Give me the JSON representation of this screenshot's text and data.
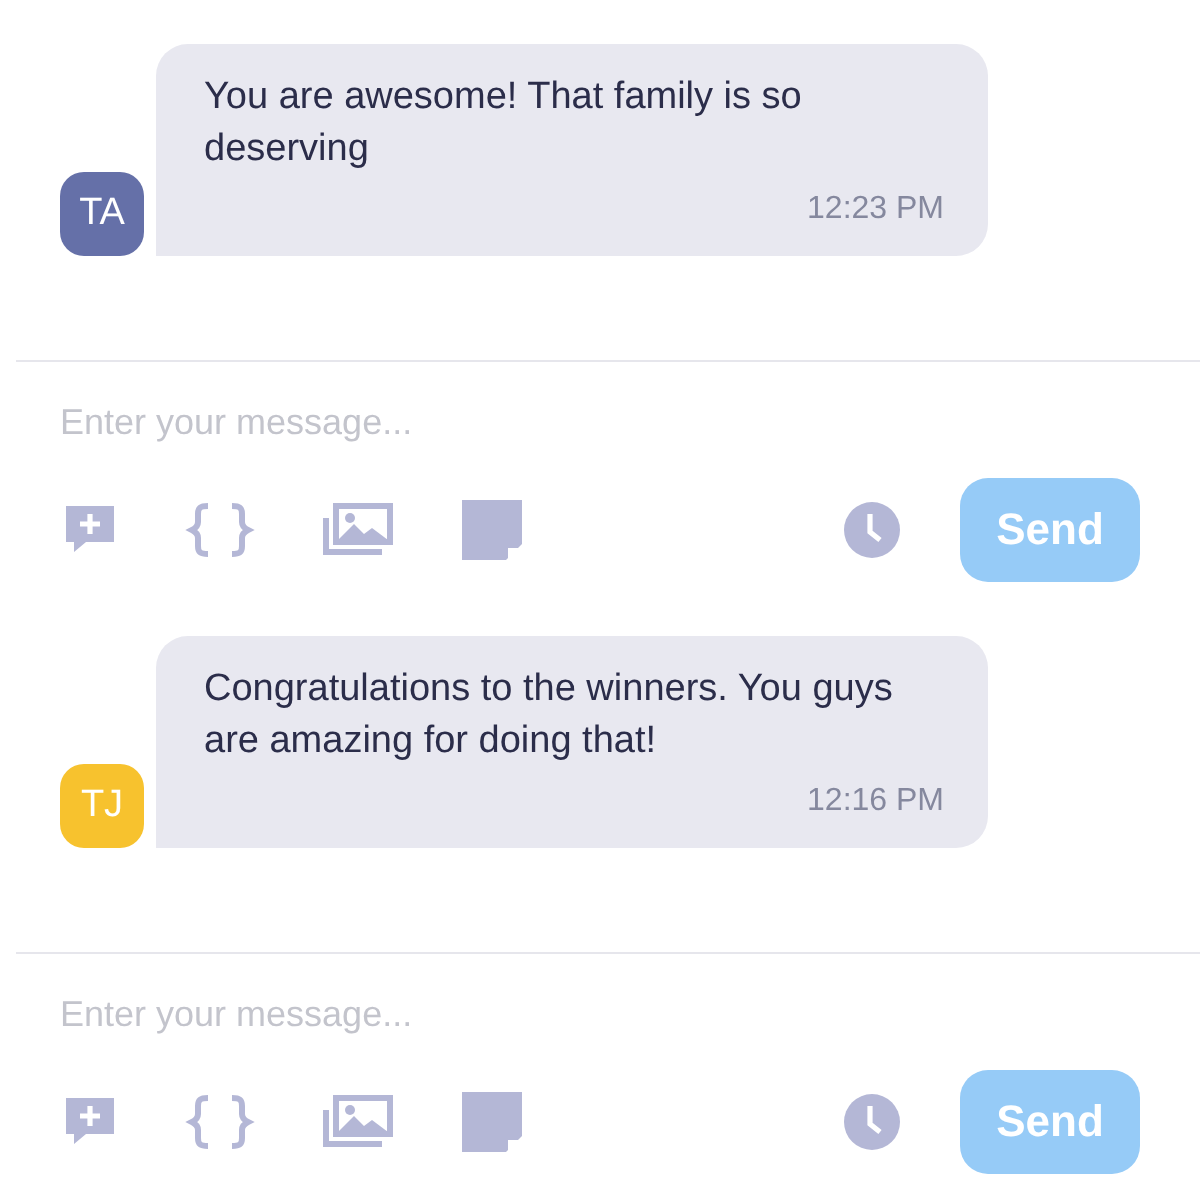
{
  "threads": [
    {
      "message": {
        "avatar": {
          "initials": "TA",
          "color": "#6570a8"
        },
        "text": "You are awesome! That family is so deserving",
        "time": "12:23 PM"
      },
      "composer": {
        "placeholder": "Enter your message...",
        "send": {
          "label": "Send",
          "disabled": true
        }
      }
    },
    {
      "message": {
        "avatar": {
          "initials": "TJ",
          "color": "#f7c22e"
        },
        "text": "Congratulations to the winners.  You guys are amazing for doing that!",
        "time": "12:16 PM"
      },
      "composer": {
        "placeholder": "Enter your message...",
        "send": {
          "label": "Send",
          "disabled": true
        }
      }
    }
  ]
}
